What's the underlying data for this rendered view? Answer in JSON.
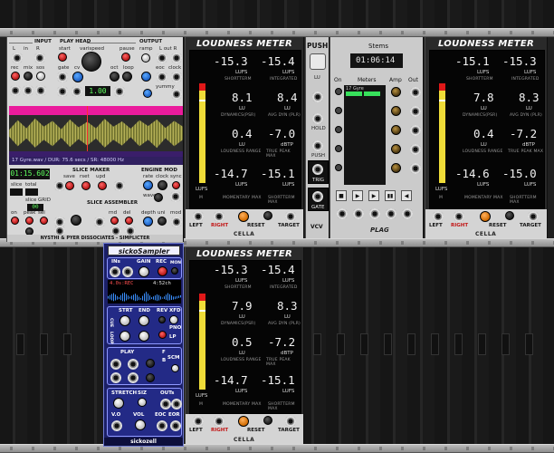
{
  "simplicter": {
    "sections": {
      "input": "INPUT",
      "playhead": "PLAY HEAD",
      "output": "OUTPUT",
      "slicemaker": "SLICE MAKER",
      "enginemod": "ENGINE MOD",
      "grid": "GRID",
      "sliceassembler": "SLICE ASSEMBLER"
    },
    "labels": {
      "l": "L",
      "in": "in",
      "r": "R",
      "rec": "rec",
      "mix": "mix",
      "sos": "sos",
      "start": "start",
      "varispeed": "varispeed",
      "pause": "pause",
      "gate": "gate",
      "cv": "cv",
      "oct": "oct",
      "loop": "loop",
      "ramp": "ramp",
      "lout": "L out R",
      "eoc": "eoc",
      "clock": "clock",
      "yummy": "yummy",
      "save": "save",
      "rset": "rset",
      "upd": "upd",
      "rate": "rate",
      "clk": "clock",
      "sync": "sync",
      "wave": "wave",
      "on": "on",
      "peak": "peak",
      "sel": "sel",
      "rnd": "rnd",
      "del": "del",
      "depth": "depth",
      "uni": "uni",
      "mod": "mod",
      "slice": "slice",
      "total": "total"
    },
    "speed_value": "1.00",
    "time_readout": "01:15.602",
    "slice_grid_value": "00",
    "info_bar": "17 Gyre.wav / DUR: 75.6 secs / SR: 48000 Hz",
    "footer": "NYSTHI & PYER DISSOCIATES - SIMPLICTER"
  },
  "meters": [
    {
      "title": "LOUDNESS METER",
      "shortterm": "-15.3",
      "integrated": "-15.4",
      "dynamics": "8.1",
      "avgdyn": "8.4",
      "loudrange": "0.4",
      "truepeak": "-7.0",
      "momentary": "-14.7",
      "shorttermmax": "-15.1",
      "bar_fill": 0.82
    },
    {
      "title": "LOUDNESS METER",
      "shortterm": "-15.1",
      "integrated": "-15.3",
      "dynamics": "7.8",
      "avgdyn": "8.3",
      "loudrange": "0.4",
      "truepeak": "-7.2",
      "momentary": "-14.6",
      "shorttermmax": "-15.0",
      "bar_fill": 0.8
    },
    {
      "title": "LOUDNESS METER",
      "shortterm": "-15.3",
      "integrated": "-15.4",
      "dynamics": "7.9",
      "avgdyn": "8.3",
      "loudrange": "0.5",
      "truepeak": "-7.2",
      "momentary": "-14.7",
      "shorttermmax": "-15.1",
      "bar_fill": 0.82
    }
  ],
  "meter_labels": {
    "lufs": "LUFS",
    "lu": "LU",
    "dbtp": "dBTP",
    "shortterm": "SHORTTERM",
    "integrated": "INTEGRATED",
    "dynamics": "DYNAMICS(PSR)",
    "avgdyn": "AVG DYN (PLR)",
    "loudrange": "LOUDNESS RANGE",
    "truepeak": "TRUE PEAK MAX",
    "m": "M",
    "momentarymax": "MOMENTARY MAX",
    "shorttermmax": "SHORTTERM MAX",
    "left": "LEFT",
    "right": "RIGHT",
    "reset": "RESET",
    "target": "TARGET",
    "brand": "CELLA",
    "scale": [
      "-3",
      "-6",
      "-9",
      "-18",
      "-23",
      "-36",
      "-45",
      "-54"
    ]
  },
  "push": {
    "title": "PUSH",
    "labels": {
      "lu": "LU",
      "hold": "HOLD",
      "push": "PUSH",
      "trig": "TRIG",
      "gate": "GATE",
      "brand": "VCV"
    }
  },
  "stems": {
    "title": "Stems",
    "clock": "01:06:14",
    "col_on": "On",
    "col_meters": "Meters",
    "col_amp": "Amp",
    "col_out": "Out",
    "file": "17 Gyre",
    "brand": "PLAG"
  },
  "sicko": {
    "title": "sickoSampler",
    "labels": {
      "ins": "INs",
      "gain": "GAIN",
      "rec": "REC",
      "mon": "MON",
      "strt": "STRT",
      "end": "END",
      "rev": "REV",
      "xfd": "XFD",
      "pno": "PNO",
      "lp": "LP",
      "cue": "CUE",
      "loop": "LOOP",
      "play": "PLAY",
      "scm": "SCM",
      "stretch": "STRETCH",
      "siz": "SIZ",
      "outs": "OUTs",
      "vo": "V.O",
      "vol": "VOL",
      "eoc": "EOC",
      "eor": "EOR",
      "f": "F",
      "b": "B"
    },
    "screen_left": "4.0s:REC",
    "screen_right": "4:52ch",
    "brand": "sickozell"
  }
}
